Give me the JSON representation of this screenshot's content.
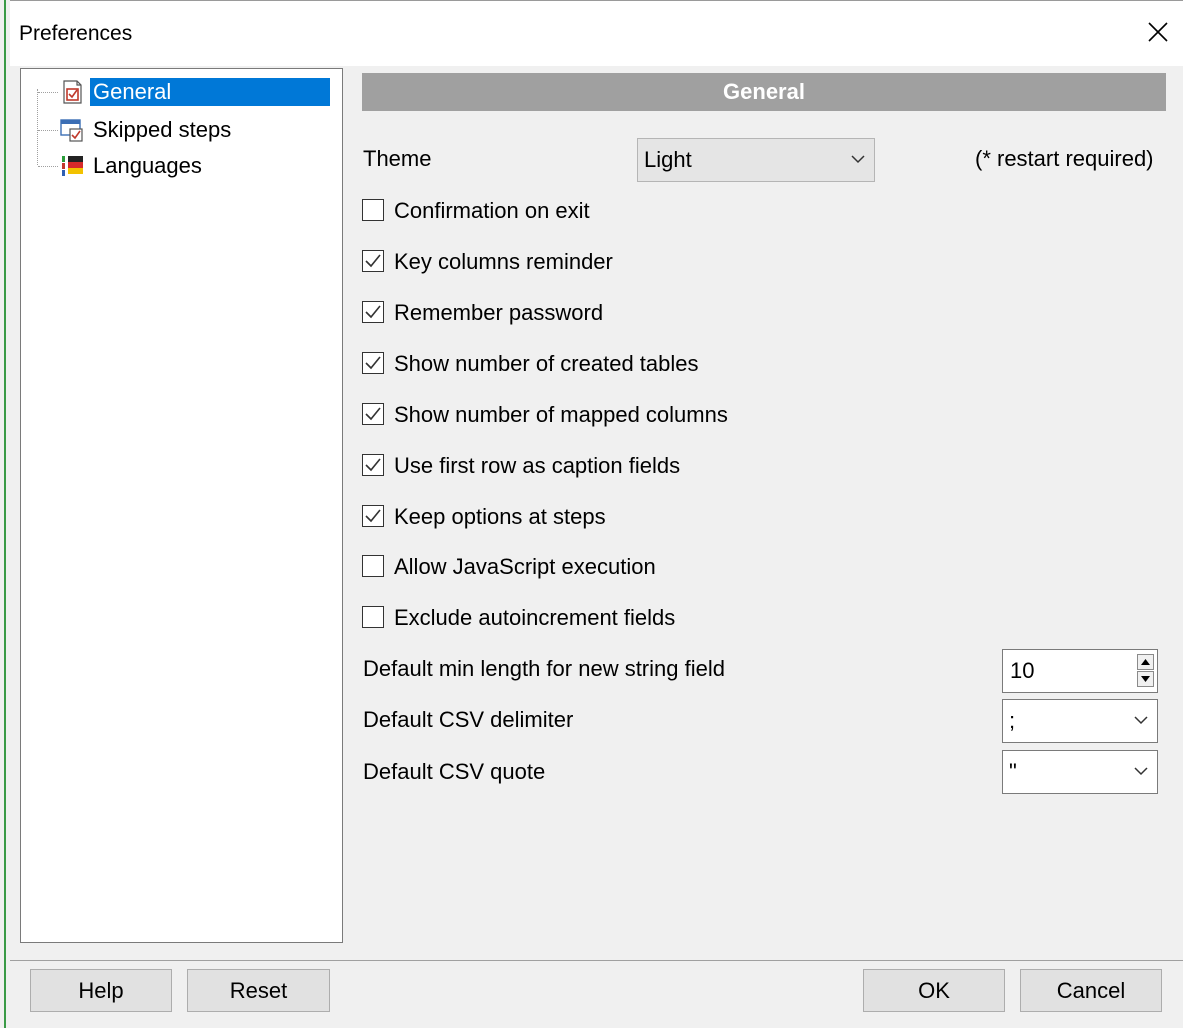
{
  "window": {
    "title": "Preferences"
  },
  "tree": {
    "items": [
      {
        "label": "General",
        "icon": "general-page-icon",
        "selected": true
      },
      {
        "label": "Skipped steps",
        "icon": "skipped-steps-icon",
        "selected": false
      },
      {
        "label": "Languages",
        "icon": "languages-flag-icon",
        "selected": false
      }
    ]
  },
  "section": {
    "title": "General"
  },
  "theme": {
    "label": "Theme",
    "value": "Light",
    "note": "(* restart required)"
  },
  "options": [
    {
      "label": "Confirmation on exit",
      "checked": false
    },
    {
      "label": "Key columns reminder",
      "checked": true
    },
    {
      "label": "Remember password",
      "checked": true
    },
    {
      "label": "Show number of created tables",
      "checked": true
    },
    {
      "label": "Show number of mapped columns",
      "checked": true
    },
    {
      "label": "Use first row as caption fields",
      "checked": true
    },
    {
      "label": "Keep options at steps",
      "checked": true
    },
    {
      "label": "Allow JavaScript execution",
      "checked": false
    },
    {
      "label": "Exclude autoincrement fields",
      "checked": false
    }
  ],
  "min_length": {
    "label": "Default min length for new string field",
    "value": "10"
  },
  "csv_delimiter": {
    "label": "Default CSV delimiter",
    "value": ";"
  },
  "csv_quote": {
    "label": "Default CSV quote",
    "value": "\""
  },
  "buttons": {
    "help": "Help",
    "reset": "Reset",
    "ok": "OK",
    "cancel": "Cancel"
  },
  "colors": {
    "selection": "#0078d7",
    "header_bar": "#a0a0a0",
    "dialog_bg": "#f0f0f0"
  }
}
